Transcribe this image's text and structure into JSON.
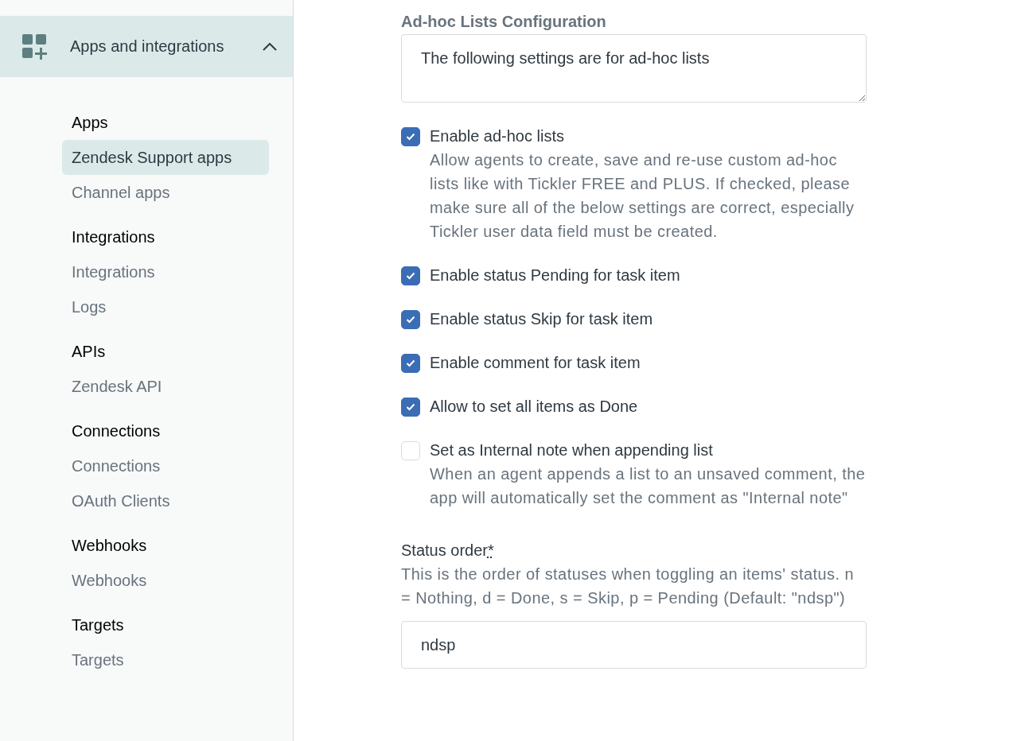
{
  "sidebar": {
    "header": {
      "label": "Apps and integrations",
      "expanded": true
    },
    "sections": [
      {
        "title": "Apps",
        "items": [
          {
            "label": "Zendesk Support apps",
            "selected": true
          },
          {
            "label": "Channel apps",
            "selected": false
          }
        ]
      },
      {
        "title": "Integrations",
        "items": [
          {
            "label": "Integrations",
            "selected": false
          },
          {
            "label": "Logs",
            "selected": false
          }
        ]
      },
      {
        "title": "APIs",
        "items": [
          {
            "label": "Zendesk API",
            "selected": false
          }
        ]
      },
      {
        "title": "Connections",
        "items": [
          {
            "label": "Connections",
            "selected": false
          },
          {
            "label": "OAuth Clients",
            "selected": false
          }
        ]
      },
      {
        "title": "Webhooks",
        "items": [
          {
            "label": "Webhooks",
            "selected": false
          }
        ]
      },
      {
        "title": "Targets",
        "items": [
          {
            "label": "Targets",
            "selected": false
          }
        ]
      }
    ]
  },
  "form": {
    "title": "Ad-hoc Lists Configuration",
    "intro": {
      "value": "The following settings are for ad-hoc lists"
    },
    "options": [
      {
        "label": "Enable ad-hoc lists",
        "checked": true,
        "description": "Allow agents to create, save and re-use custom ad-hoc lists like with Tickler FREE and PLUS. If checked, please make sure all of the below settings are correct, especially Tickler user data field must be created."
      },
      {
        "label": "Enable status Pending for task item",
        "checked": true
      },
      {
        "label": "Enable status Skip for task item",
        "checked": true
      },
      {
        "label": "Enable comment for task item",
        "checked": true
      },
      {
        "label": "Allow to set all items as Done",
        "checked": true
      },
      {
        "label": "Set as Internal note when appending list",
        "checked": false,
        "description": "When an agent appends a list to an unsaved comment, the app will automatically set the comment as \"Internal note\""
      }
    ],
    "status_order": {
      "label": "Status order",
      "required_mark": "*",
      "hint": "This is the order of statuses when toggling an items' status. n = Nothing, d = Done, s = Skip, p = Pending (Default: \"ndsp\")",
      "value": "ndsp"
    }
  }
}
